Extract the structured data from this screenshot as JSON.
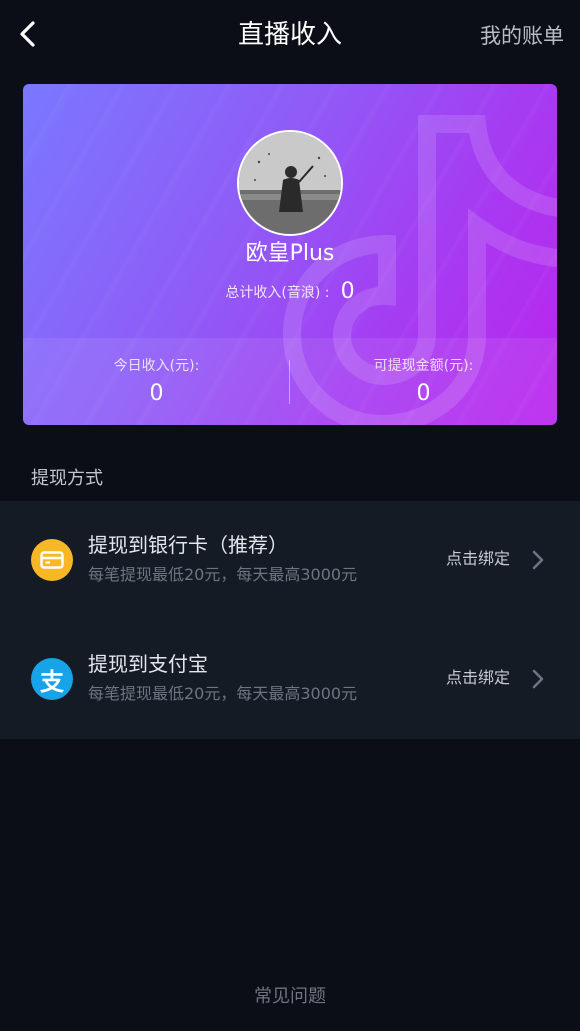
{
  "header": {
    "title": "直播收入",
    "account_link": "我的账单"
  },
  "profile": {
    "nickname": "欧皇Plus",
    "total_label": "总计收入(音浪) :",
    "total_value": "0"
  },
  "stats": {
    "today_label": "今日收入(元):",
    "today_value": "0",
    "withdrawable_label": "可提现金额(元):",
    "withdrawable_value": "0"
  },
  "withdraw": {
    "section_title": "提现方式",
    "methods": [
      {
        "title": "提现到银行卡（推荐）",
        "subtitle": "每笔提现最低20元，每天最高3000元",
        "action": "点击绑定",
        "icon": "bank-card-icon"
      },
      {
        "title": "提现到支付宝",
        "subtitle": "每笔提现最低20元，每天最高3000元",
        "action": "点击绑定",
        "icon": "alipay-icon",
        "icon_glyph": "支"
      }
    ]
  },
  "footer": {
    "faq": "常见问题"
  },
  "colors": {
    "background": "#0b0e17",
    "card_gradient_start": "#7a78ff",
    "card_gradient_end": "#bb24ee",
    "bank_icon": "#f8b826",
    "alipay_icon": "#16a3e8"
  }
}
